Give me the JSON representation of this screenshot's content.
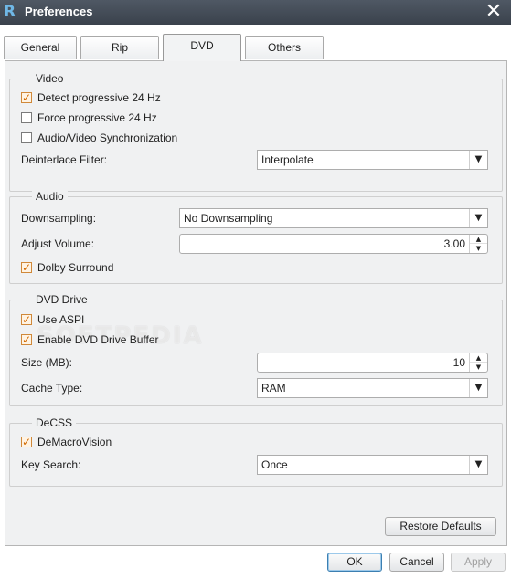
{
  "window": {
    "title": "Preferences",
    "logo_glyph": "R",
    "close_glyph": "✕"
  },
  "tabs": [
    {
      "label": "General",
      "active": false
    },
    {
      "label": "Rip",
      "active": false
    },
    {
      "label": "DVD",
      "active": true
    },
    {
      "label": "Others",
      "active": false
    }
  ],
  "video": {
    "title": "Video",
    "detect_progressive": {
      "label": "Detect progressive 24 Hz",
      "checked": true
    },
    "force_progressive": {
      "label": "Force progressive 24 Hz",
      "checked": false
    },
    "av_sync": {
      "label": "Audio/Video Synchronization",
      "checked": false
    },
    "deinterlace_label": "Deinterlace Filter:",
    "deinterlace_value": "Interpolate"
  },
  "audio": {
    "title": "Audio",
    "downsampling_label": "Downsampling:",
    "downsampling_value": "No Downsampling",
    "adjust_volume_label": "Adjust Volume:",
    "adjust_volume_value": "3.00",
    "dolby": {
      "label": "Dolby Surround",
      "checked": true
    }
  },
  "dvd_drive": {
    "title": "DVD Drive",
    "use_aspi": {
      "label": "Use ASPI",
      "checked": true
    },
    "enable_buffer": {
      "label": "Enable DVD Drive Buffer",
      "checked": true
    },
    "size_label": "Size (MB):",
    "size_value": "10",
    "cache_type_label": "Cache Type:",
    "cache_type_value": "RAM"
  },
  "decss": {
    "title": "DeCSS",
    "demacrovision": {
      "label": "DeMacroVision",
      "checked": true
    },
    "key_search_label": "Key Search:",
    "key_search_value": "Once"
  },
  "buttons": {
    "restore_defaults": "Restore Defaults",
    "ok": "OK",
    "cancel": "Cancel",
    "apply": "Apply"
  },
  "icons": {
    "dropdown": "▼",
    "spin_up": "▲",
    "spin_down": "▼"
  },
  "watermark": "SOFTPEDIA"
}
